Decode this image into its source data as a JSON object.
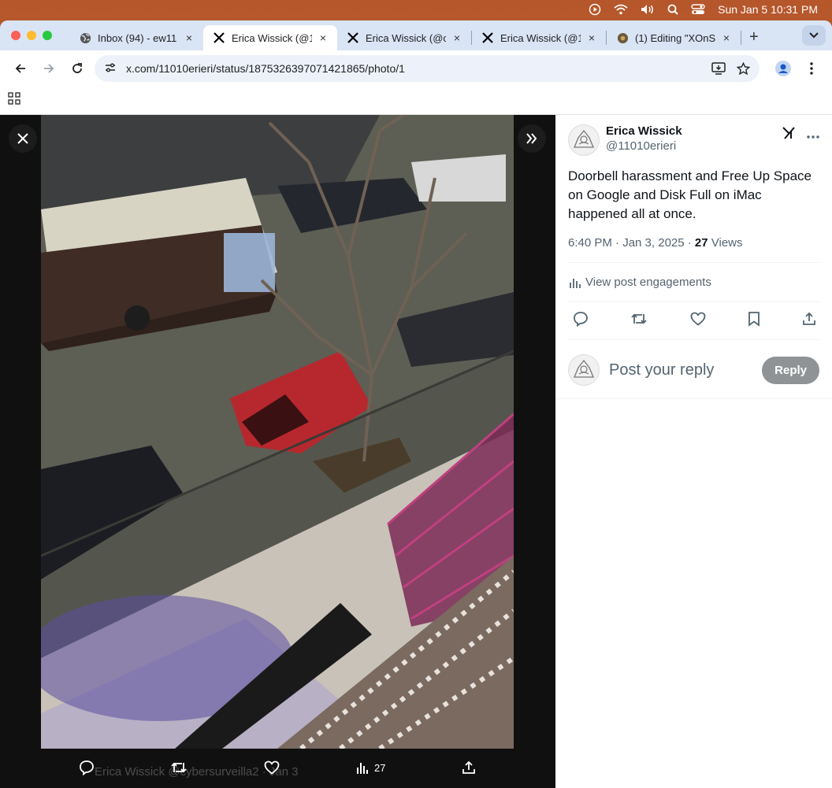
{
  "menubar": {
    "datetime": "Sun Jan 5  10:31 PM",
    "icons": [
      "play-circle-icon",
      "wifi-icon",
      "volume-icon",
      "search-icon",
      "control-center-icon"
    ]
  },
  "tabs": [
    {
      "title": "Inbox (94) - ew11",
      "icon": "globe-icon",
      "active": false
    },
    {
      "title": "Erica Wissick (@1",
      "icon": "x-logo-icon",
      "active": true
    },
    {
      "title": "Erica Wissick (@c",
      "icon": "x-logo-icon",
      "active": false
    },
    {
      "title": "Erica Wissick (@1",
      "icon": "x-logo-icon",
      "active": false
    },
    {
      "title": "(1) Editing \"XOnS",
      "icon": "substack-icon",
      "active": false
    }
  ],
  "tab_close": "×",
  "new_tab": "+",
  "address": {
    "url": "x.com/11010erieri/status/1875326397071421865/photo/1"
  },
  "post": {
    "display_name": "Erica Wissick",
    "handle": "@11010erieri",
    "text": "Doorbell harassment and Free Up Space on Google and Disk Full on iMac happened all at once.",
    "time": "6:40 PM · Jan 3, 2025 · ",
    "views_count": "27",
    "views_label": " Views",
    "engagements_label": "View post engagements",
    "reply_placeholder": "Post your reply",
    "reply_button": "Reply"
  },
  "media": {
    "views_count": "27",
    "background_reply": "Erica Wissick @cybersurveilla2 · Jan 3"
  },
  "colors": {
    "accent": "#1d9bf0",
    "text": "#0f1419",
    "muted": "#536471",
    "reply_button": "#8f9396"
  }
}
